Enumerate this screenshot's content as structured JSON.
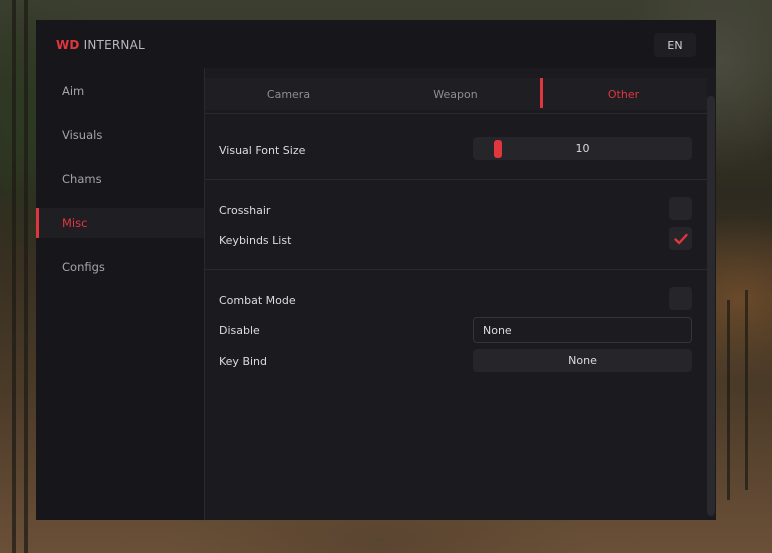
{
  "app": {
    "brand_accent": "WD",
    "brand_rest": " INTERNAL",
    "language": "EN",
    "accent_color": "#e0373f"
  },
  "sidebar": {
    "items": [
      {
        "label": "Aim",
        "active": false
      },
      {
        "label": "Visuals",
        "active": false
      },
      {
        "label": "Chams",
        "active": false
      },
      {
        "label": "Misc",
        "active": true
      },
      {
        "label": "Configs",
        "active": false
      }
    ]
  },
  "tabs": [
    {
      "label": "Camera",
      "active": false
    },
    {
      "label": "Weapon",
      "active": false
    },
    {
      "label": "Other",
      "active": true
    }
  ],
  "settings": {
    "visual_font_size": {
      "label": "Visual Font Size",
      "value": "10",
      "fraction": 0.1
    },
    "crosshair": {
      "label": "Crosshair",
      "checked": false
    },
    "keybinds_list": {
      "label": "Keybinds List",
      "checked": true
    },
    "combat_mode": {
      "label": "Combat Mode",
      "checked": false
    },
    "disable": {
      "label": "Disable",
      "value": "None"
    },
    "key_bind": {
      "label": "Key Bind",
      "value": "None"
    }
  }
}
